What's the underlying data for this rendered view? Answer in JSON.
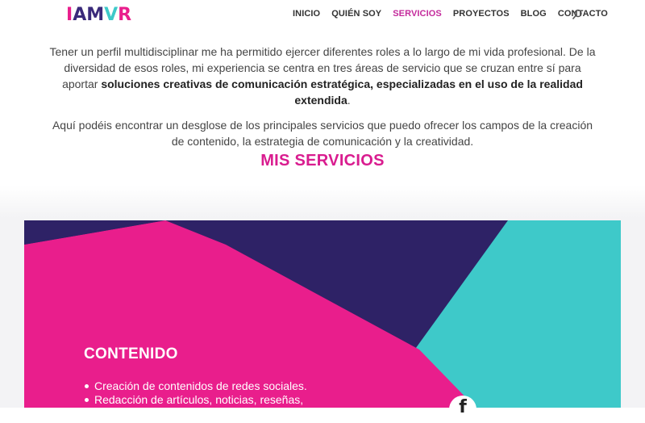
{
  "header": {
    "logo_text": "IAMVR",
    "nav": [
      {
        "label": "INICIO"
      },
      {
        "label": "QUIÉN SOY"
      },
      {
        "label": "SERVICIOS"
      },
      {
        "label": "PROYECTOS"
      },
      {
        "label": "BLOG"
      },
      {
        "label": "CONTACTO"
      }
    ],
    "active_nav": "SERVICIOS",
    "search_icon": "search-icon"
  },
  "intro": {
    "p1_start": "Tener un perfil multidisciplinar me ha permitido ejercer diferentes roles a lo largo de mi vida profesional. De la diversidad de esos roles, mi experiencia se centra en tres áreas de servicio que se cruzan entre sí para aportar ",
    "p1_bold": "soluciones creativas de comunicación estratégica, especializadas en el uso de la realidad extendida",
    "p1_end": ".",
    "p2": "Aquí podéis encontrar un desglose de los principales servicios que puedo ofrecer los campos de la creación de contenido, la estrategia de comunicación y la creatividad."
  },
  "section_title": "MIS SERVICIOS",
  "card": {
    "title": "CONTENIDO",
    "items": [
      "Creación de contenidos de redes sociales.",
      "Redacción de artículos, noticias, reseñas,"
    ],
    "social_icon": "facebook-icon"
  },
  "colors": {
    "pink": "#e91e8c",
    "navy": "#2e2266",
    "teal": "#3ec9c9",
    "accent_text": "#d91c8f",
    "active_nav": "#c42b9c"
  }
}
